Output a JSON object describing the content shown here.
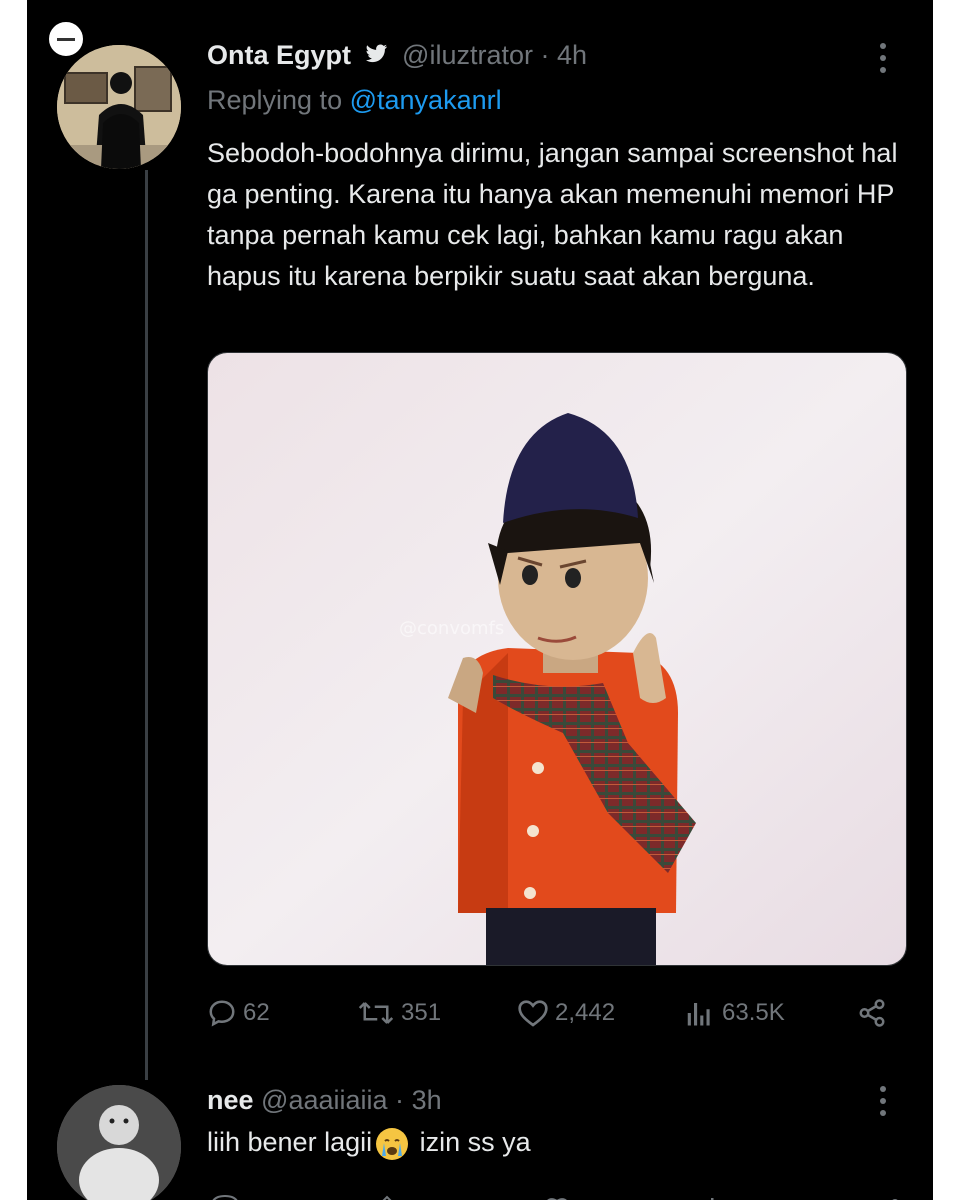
{
  "tweet": {
    "author_name": "Onta Egypt",
    "author_handle": "@iluztrator",
    "separator": "·",
    "time": "4h",
    "replying_prefix": "Replying to",
    "replying_to": "@tanyakanrl",
    "text": "Sebodoh-bodohnya dirimu, jangan sampai screenshot hal ga penting. Karena itu hanya akan memenuhi memori HP tanpa pernah kamu cek lagi, bahkan kamu ragu akan hapus itu karena berpikir suatu saat akan berguna.",
    "media_watermark": "@convomfs",
    "stats": {
      "replies": "62",
      "retweets": "351",
      "likes": "2,442",
      "views": "63.5K"
    }
  },
  "reply": {
    "author_name": "nee",
    "author_handle": "@aaaiiaiia",
    "separator": "·",
    "time": "3h",
    "text_before_emoji": "liih bener lagii",
    "text_after_emoji": "izin ss ya",
    "emoji": "crying-face"
  },
  "colors": {
    "background": "#000000",
    "primary_text": "#e7e9ea",
    "secondary_text": "#71767b",
    "accent": "#1d9bf0"
  },
  "icons": [
    "more-icon",
    "verified-icon",
    "reply-icon",
    "retweet-icon",
    "like-icon",
    "views-icon",
    "share-icon",
    "crying-emoji-icon"
  ]
}
